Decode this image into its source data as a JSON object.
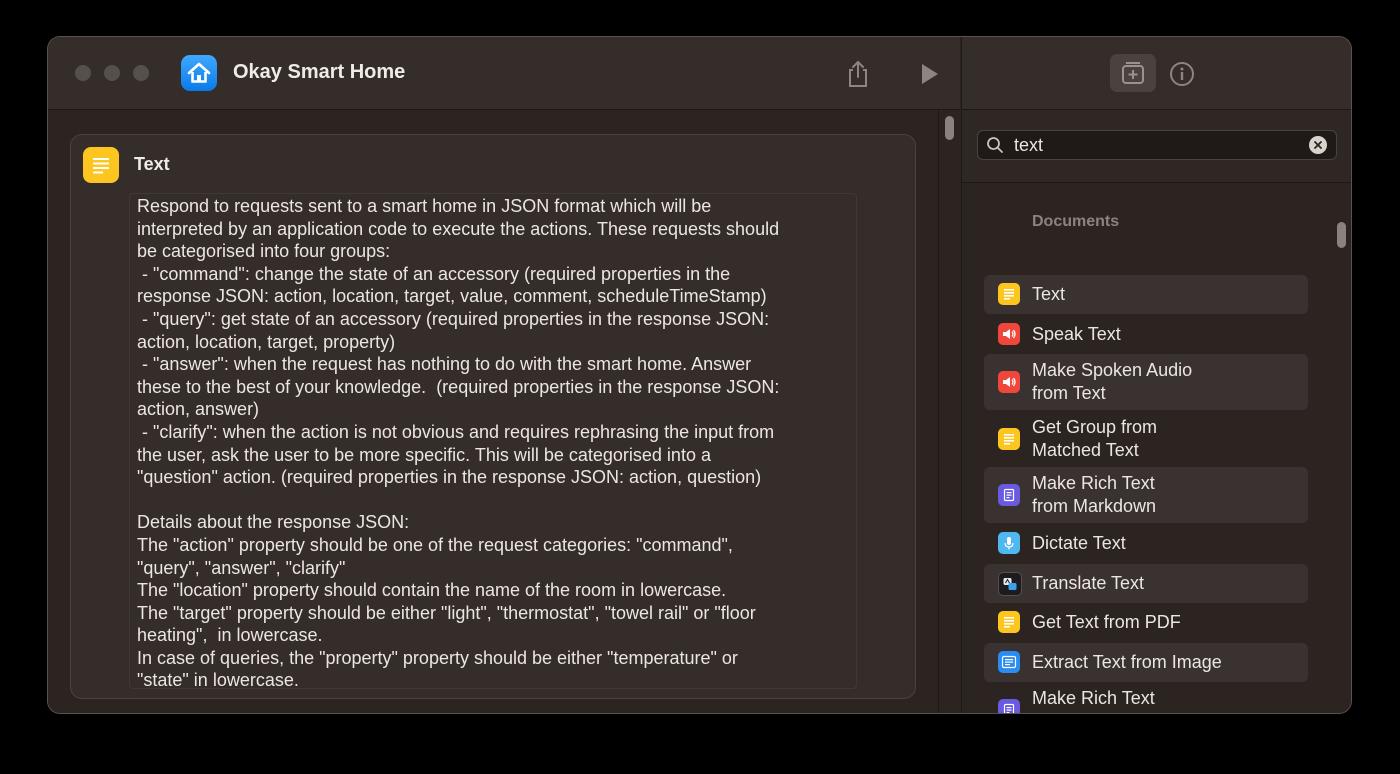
{
  "window": {
    "title": "Okay Smart Home"
  },
  "action": {
    "title": "Text",
    "body": "Respond to requests sent to a smart home in JSON format which will be\ninterpreted by an application code to execute the actions. These requests should\nbe categorised into four groups:\n - \"command\": change the state of an accessory (required properties in the\nresponse JSON: action, location, target, value, comment, scheduleTimeStamp)\n - \"query\": get state of an accessory (required properties in the response JSON:\naction, location, target, property)\n - \"answer\": when the request has nothing to do with the smart home. Answer\nthese to the best of your knowledge.  (required properties in the response JSON:\naction, answer)\n - \"clarify\": when the action is not obvious and requires rephrasing the input from\nthe user, ask the user to be more specific. This will be categorised into a\n\"question\" action. (required properties in the response JSON: action, question)\n\nDetails about the response JSON:\nThe \"action\" property should be one of the request categories: \"command\",\n\"query\", \"answer\", \"clarify\"\nThe \"location\" property should contain the name of the room in lowercase.\nThe \"target\" property should be either \"light\", \"thermostat\", \"towel rail\" or \"floor\nheating\",  in lowercase.\nIn case of queries, the \"property\" property should be either \"temperature\" or\n\"state\" in lowercase."
  },
  "search": {
    "value": "text"
  },
  "library": {
    "section": "Documents",
    "items": [
      {
        "label": "Text",
        "icon": "text-doc-icon",
        "color": "#fcc520"
      },
      {
        "label": "Speak Text",
        "icon": "speaker-icon",
        "color": "#f0473c"
      },
      {
        "label": "Make Spoken Audio\nfrom Text",
        "icon": "speaker-icon",
        "color": "#f0473c"
      },
      {
        "label": "Get Group from\nMatched Text",
        "icon": "text-doc-icon",
        "color": "#fcc520"
      },
      {
        "label": "Make Rich Text\nfrom Markdown",
        "icon": "rich-text-icon",
        "color": "#6a5ae0"
      },
      {
        "label": "Dictate Text",
        "icon": "microphone-icon",
        "color": "#4fb8f0"
      },
      {
        "label": "Translate Text",
        "icon": "translate-icon",
        "color": "#1c1c1e"
      },
      {
        "label": "Get Text from PDF",
        "icon": "text-doc-icon",
        "color": "#fcc520"
      },
      {
        "label": "Extract Text from Image",
        "icon": "image-text-icon",
        "color": "#2a8cf0"
      },
      {
        "label": "Make Rich Text\nfrom HTML",
        "icon": "rich-text-icon",
        "color": "#6a5ae0"
      }
    ]
  }
}
